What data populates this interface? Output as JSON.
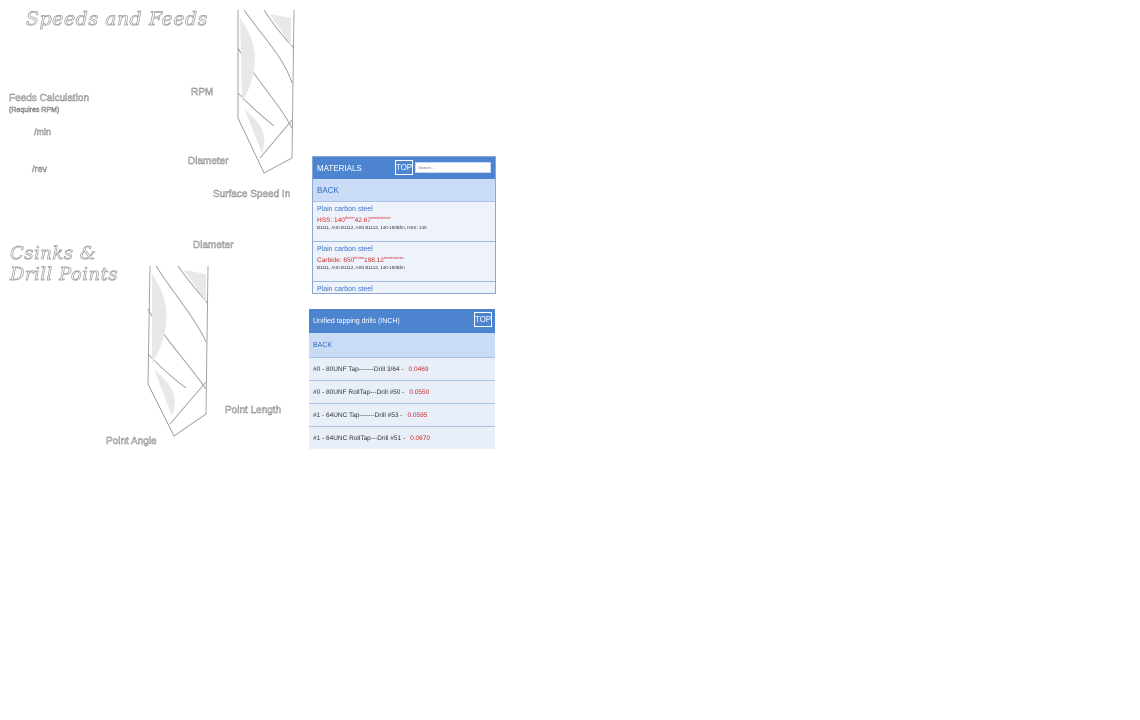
{
  "speeds_feeds": {
    "title": "Speeds and Feeds",
    "labels": {
      "rpm": "RPM",
      "feeds_calc": "Feeds Calculation",
      "feeds_requires": "(Requires RPM)",
      "per_min": "/min",
      "per_rev": "/rev",
      "diameter": "Diameter",
      "surface_speed": "Surface Speed In"
    }
  },
  "csinks": {
    "title_line1": "Csinks &",
    "title_line2": "Drill Points",
    "labels": {
      "diameter": "Diameter",
      "point_length": "Point Length",
      "point_angle": "Point Angle"
    }
  },
  "materials_panel": {
    "title": "MATERIALS",
    "top_label": "TOP",
    "search_placeholder": "Search...",
    "back_label": "BACK",
    "items": [
      {
        "name": "Plain carbon steel",
        "speed_prefix": "HSS: 140",
        "speed_unit1": "ft/min",
        "speed_metric": "42.67",
        "speed_unit2": "meters/min",
        "note": "B1111, AISI B1112, AISI B1113, 140-180Bhn, HSS: 140"
      },
      {
        "name": "Plain carbon steel",
        "speed_prefix": "Carbide: 650",
        "speed_unit1": "ft/min",
        "speed_metric": "198.12",
        "speed_unit2": "meters/min",
        "note": "B1111, AISI B1112, AISI B1113, 140-180Bhn"
      },
      {
        "name": "Plain carbon steel"
      }
    ]
  },
  "tap_panel": {
    "title": "Unified tapping drills (INCH)",
    "top_label": "TOP",
    "back_label": "BACK",
    "rows": [
      {
        "label": "#0 - 80UNF Tap-------Drill 3/64 -",
        "size": "0.0469"
      },
      {
        "label": "#0 - 80UNF RollTap---Drill #50 -",
        "size": "0.0550"
      },
      {
        "label": "#1 - 64UNC Tap-------Drill #53 -",
        "size": "0.0595"
      },
      {
        "label": "#1 - 64UNC RollTap---Drill #51 -",
        "size": "0.0670"
      }
    ]
  },
  "colors": {
    "header_blue": "#4d84cf",
    "back_blue": "#c9dbf5",
    "accent_red": "#c8252a"
  }
}
